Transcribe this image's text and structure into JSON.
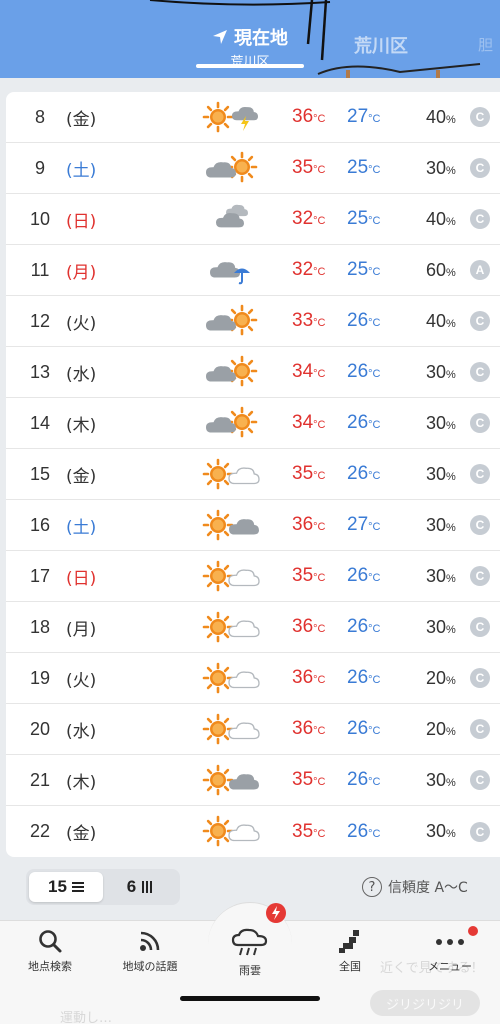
{
  "header": {
    "current_tab_label": "現在地",
    "current_tab_sub": "荒川区",
    "next_tab_label": "荒川区",
    "peek_tab_label": "胆"
  },
  "forecast": [
    {
      "day": "8",
      "dow": "(金)",
      "dow_type": "weekday",
      "icon": "sun-thunder-icon",
      "hi": "36",
      "lo": "27",
      "pop": "40",
      "rel": "C"
    },
    {
      "day": "9",
      "dow": "(土)",
      "dow_type": "sat",
      "icon": "cloud-sun-icon",
      "hi": "35",
      "lo": "25",
      "pop": "30",
      "rel": "C"
    },
    {
      "day": "10",
      "dow": "(日)",
      "dow_type": "sun",
      "icon": "cloud-icon",
      "hi": "32",
      "lo": "25",
      "pop": "40",
      "rel": "C"
    },
    {
      "day": "11",
      "dow": "(月)",
      "dow_type": "sun",
      "icon": "cloud-umbrella-icon",
      "hi": "32",
      "lo": "25",
      "pop": "60",
      "rel": "A"
    },
    {
      "day": "12",
      "dow": "(火)",
      "dow_type": "weekday",
      "icon": "cloud-sun-icon",
      "hi": "33",
      "lo": "26",
      "pop": "40",
      "rel": "C"
    },
    {
      "day": "13",
      "dow": "(水)",
      "dow_type": "weekday",
      "icon": "cloud-sun-icon",
      "hi": "34",
      "lo": "26",
      "pop": "30",
      "rel": "C"
    },
    {
      "day": "14",
      "dow": "(木)",
      "dow_type": "weekday",
      "icon": "cloud-sun-icon",
      "hi": "34",
      "lo": "26",
      "pop": "30",
      "rel": "C"
    },
    {
      "day": "15",
      "dow": "(金)",
      "dow_type": "weekday",
      "icon": "sun-cloud-icon",
      "hi": "35",
      "lo": "26",
      "pop": "30",
      "rel": "C"
    },
    {
      "day": "16",
      "dow": "(土)",
      "dow_type": "sat",
      "icon": "sun-graycloud-icon",
      "hi": "36",
      "lo": "27",
      "pop": "30",
      "rel": "C"
    },
    {
      "day": "17",
      "dow": "(日)",
      "dow_type": "sun",
      "icon": "sun-cloud-icon",
      "hi": "35",
      "lo": "26",
      "pop": "30",
      "rel": "C"
    },
    {
      "day": "18",
      "dow": "(月)",
      "dow_type": "weekday",
      "icon": "sun-cloud-icon",
      "hi": "36",
      "lo": "26",
      "pop": "30",
      "rel": "C"
    },
    {
      "day": "19",
      "dow": "(火)",
      "dow_type": "weekday",
      "icon": "sun-cloud-icon",
      "hi": "36",
      "lo": "26",
      "pop": "20",
      "rel": "C"
    },
    {
      "day": "20",
      "dow": "(水)",
      "dow_type": "weekday",
      "icon": "sun-cloud-icon",
      "hi": "36",
      "lo": "26",
      "pop": "20",
      "rel": "C"
    },
    {
      "day": "21",
      "dow": "(木)",
      "dow_type": "weekday",
      "icon": "sun-graycloud-icon",
      "hi": "35",
      "lo": "26",
      "pop": "30",
      "rel": "C"
    },
    {
      "day": "22",
      "dow": "(金)",
      "dow_type": "weekday",
      "icon": "sun-cloud-icon",
      "hi": "35",
      "lo": "26",
      "pop": "30",
      "rel": "C"
    }
  ],
  "units": {
    "temp": "°C",
    "pop": "%"
  },
  "toggle": {
    "option1": "15",
    "option2": "6"
  },
  "legend": {
    "qmark": "?",
    "text": "信頼度 A～C"
  },
  "nav": {
    "search": "地点検索",
    "topics": "地域の話題",
    "rain": "雨雲",
    "national": "全国",
    "menu": "メニュー"
  },
  "background": {
    "ghost_text_1": "近くで見てする！",
    "ghost_text_2": "運動し…",
    "ghost_btn": "ジリジリジリ"
  },
  "colors": {
    "header_bg": "#6aa0e8",
    "high_temp": "#e0322f",
    "low_temp": "#3a7bd5",
    "saturday": "#3a7bd5",
    "sunday": "#e0322f",
    "sun": "#f08a1c",
    "cloud": "#9aa0a6"
  }
}
